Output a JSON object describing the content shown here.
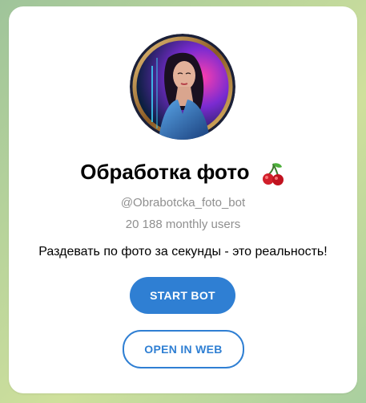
{
  "bot": {
    "title": "Обработка фото",
    "title_emoji": "cherries-icon",
    "username": "@Obrabotcka_foto_bot",
    "monthly_users": "20 188 monthly users",
    "description": "Раздевать по фото за секунды - это реальность!"
  },
  "actions": {
    "start_label": "START BOT",
    "web_label": "OPEN IN WEB"
  },
  "colors": {
    "accent": "#2f7fd3",
    "muted_text": "#8f8f8f",
    "card_bg": "#ffffff"
  }
}
